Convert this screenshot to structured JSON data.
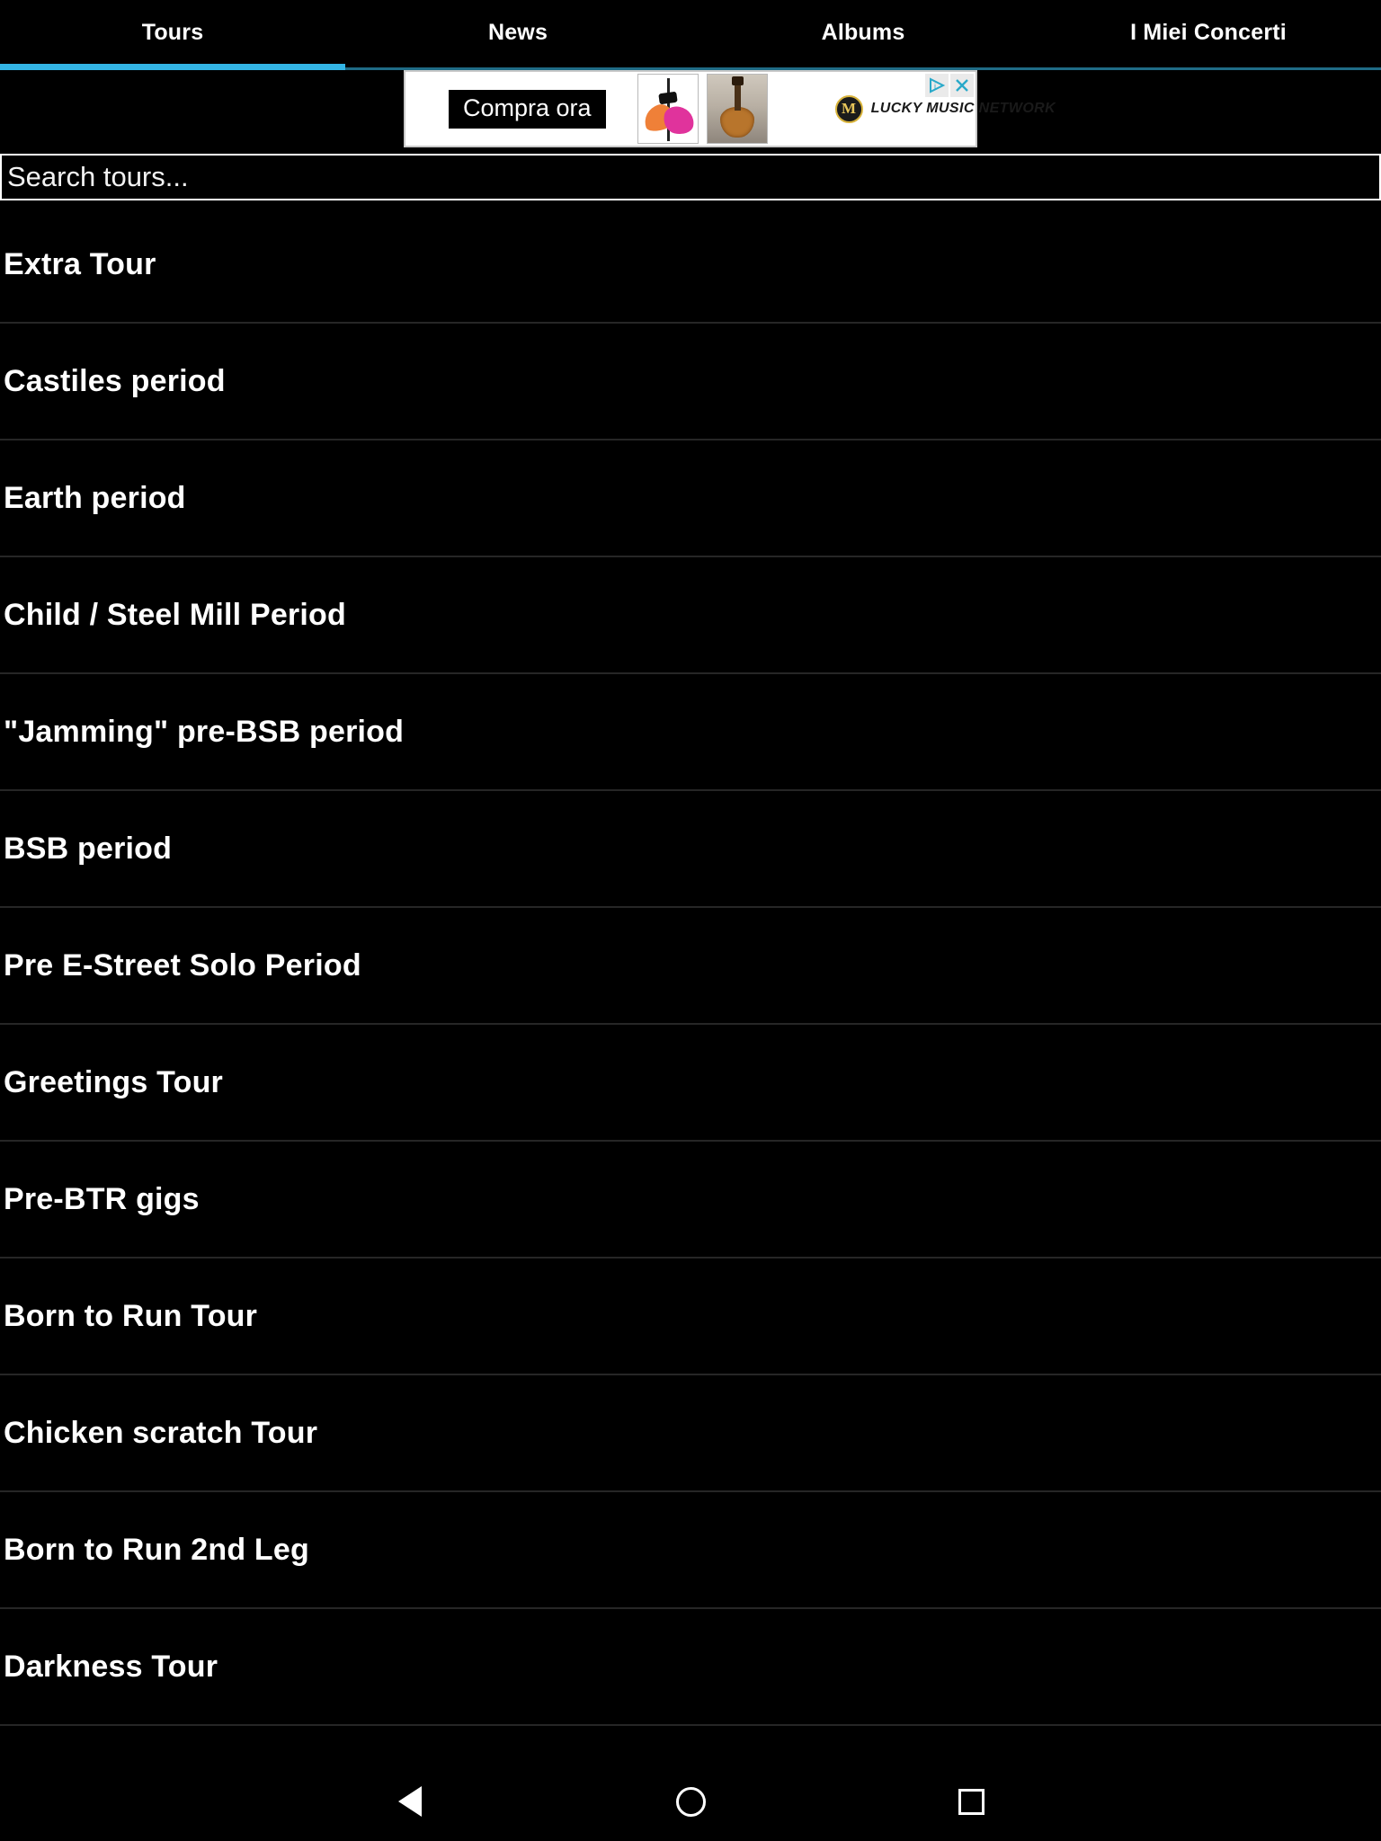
{
  "app": {
    "accent_color": "#33b5e5",
    "background_color": "#000000",
    "text_color": "#ffffff"
  },
  "tabs": {
    "active_index": 0,
    "items": [
      {
        "label": "Tours"
      },
      {
        "label": "News"
      },
      {
        "label": "Albums"
      },
      {
        "label": "I Miei Concerti"
      }
    ]
  },
  "ad": {
    "cta_label": "Compra ora",
    "advertiser": "LUCKY MUSIC NETWORK",
    "logo_letter": "M",
    "adchoices_icon": "adchoices-triangle-icon",
    "close_icon": "close-icon",
    "thumbnails": [
      {
        "alt": "microphone-windscreens-thumbnail"
      },
      {
        "alt": "guitars-on-wall-thumbnail"
      }
    ]
  },
  "search": {
    "placeholder": "Search tours...",
    "value": ""
  },
  "tour_list": {
    "items": [
      {
        "label": "Extra Tour"
      },
      {
        "label": "Castiles period"
      },
      {
        "label": "Earth period"
      },
      {
        "label": "Child / Steel Mill Period"
      },
      {
        "label": "\"Jamming\" pre-BSB period"
      },
      {
        "label": "BSB period"
      },
      {
        "label": "Pre E-Street Solo Period"
      },
      {
        "label": "Greetings Tour"
      },
      {
        "label": "Pre-BTR gigs"
      },
      {
        "label": "Born to Run Tour"
      },
      {
        "label": "Chicken scratch Tour"
      },
      {
        "label": "Born to Run 2nd Leg"
      },
      {
        "label": "Darkness Tour"
      }
    ]
  },
  "navbar": {
    "buttons": [
      {
        "name": "back",
        "icon": "back-triangle-icon"
      },
      {
        "name": "home",
        "icon": "home-circle-icon"
      },
      {
        "name": "recents",
        "icon": "recents-square-icon"
      }
    ]
  }
}
